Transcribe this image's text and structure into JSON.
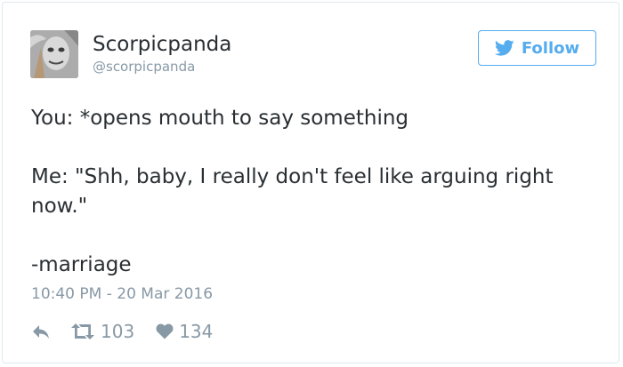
{
  "tweet": {
    "author": {
      "display_name": "Scorpicpanda",
      "handle": "@scorpicpanda",
      "avatar_icon": "avatar-photo"
    },
    "follow_button": {
      "label": "Follow",
      "icon": "twitter-bird-icon",
      "color": "#55acee"
    },
    "text_lines": [
      "You: *opens mouth to say something",
      "Me: \"Shh, baby, I really don't feel like arguing right",
      "now.\"",
      "-marriage"
    ],
    "timestamp": "10:40 PM - 20 Mar 2016",
    "actions": {
      "reply_icon": "reply-icon",
      "retweet_icon": "retweet-icon",
      "retweet_count": "103",
      "like_icon": "heart-icon",
      "like_count": "134"
    }
  }
}
